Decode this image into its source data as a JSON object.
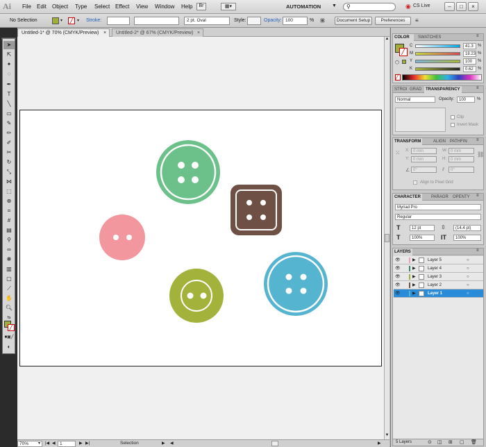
{
  "app": {
    "logo": "Ai"
  },
  "menu": {
    "items": [
      "File",
      "Edit",
      "Object",
      "Type",
      "Select",
      "Effect",
      "View",
      "Window",
      "Help"
    ],
    "workspace": "AUTOMATION",
    "search_placeholder": "",
    "cslive": "CS Live",
    "window_buttons": [
      "–",
      "□",
      "×"
    ]
  },
  "control": {
    "selection": "No Selection",
    "stroke_label": "Stroke:",
    "brush": "2 pt. Oval",
    "style_label": "Style:",
    "opacity_label": "Opacity:",
    "opacity_value": "100",
    "opacity_unit": "%",
    "document_setup": "Document Setup",
    "preferences": "Preferences"
  },
  "tabs": [
    {
      "label": "Untitled-1* @ 70% (CMYK/Preview)",
      "close": "×"
    },
    {
      "label": "Untitled-2* @ 67% (CMYK/Preview)",
      "close": "×"
    }
  ],
  "status": {
    "zoom": "70%",
    "page": "1",
    "mode": "Selection"
  },
  "color_panel": {
    "tabs": [
      "COLOR",
      "SWATCHES"
    ],
    "channels": [
      {
        "label": "C",
        "value": "41.3",
        "unit": "%"
      },
      {
        "label": "M",
        "value": "18.23",
        "unit": "%"
      },
      {
        "label": "Y",
        "value": "100",
        "unit": "%"
      },
      {
        "label": "K",
        "value": "0.62",
        "unit": "%"
      }
    ],
    "fill_color": "#a2ae3a"
  },
  "transparency_panel": {
    "tabs": [
      "STROI",
      "GRAD",
      "TRANSPARENCY"
    ],
    "blend_mode": "Normal",
    "opacity_label": "Opacity:",
    "opacity_value": "100",
    "opacity_unit": "%",
    "clip_label": "Clip",
    "invert_label": "Invert Mask"
  },
  "transform_panel": {
    "tabs": [
      "TRANSFORM",
      "ALIGN",
      "PATHFIN"
    ],
    "x_label": "X:",
    "x_value": "0 mm",
    "y_label": "Y:",
    "y_value": "0 mm",
    "w_label": "W:",
    "w_value": "0 mm",
    "h_label": "H:",
    "h_value": "0 mm",
    "rotate_value": "0°",
    "shear_value": "0°",
    "align_pixel_label": "Align to Pixel Grid"
  },
  "character_panel": {
    "tabs": [
      "CHARACTER",
      "PARAGR",
      "OPENTY"
    ],
    "font": "Myriad Pro",
    "style": "Regular",
    "size": "12 pt",
    "leading": "(14.4 pt)",
    "hscale": "100%",
    "vscale": "100%"
  },
  "layers_panel": {
    "title": "LAYERS",
    "layers": [
      {
        "name": "Layer 5",
        "color": "#f29db5",
        "selected": false
      },
      {
        "name": "Layer 4",
        "color": "#2e8d6d",
        "selected": false
      },
      {
        "name": "Layer 3",
        "color": "#a2ae3a",
        "selected": false
      },
      {
        "name": "Layer 2",
        "color": "#6f5146",
        "selected": false
      },
      {
        "name": "Layer 1",
        "color": "#59b4cf",
        "selected": true
      }
    ],
    "footer": "5 Layers"
  },
  "buttons_art": {
    "green": "#6cc08a",
    "brown": "#6e5045",
    "pink": "#f3979f",
    "olive": "#a2b23a",
    "blue": "#55b4cf"
  }
}
